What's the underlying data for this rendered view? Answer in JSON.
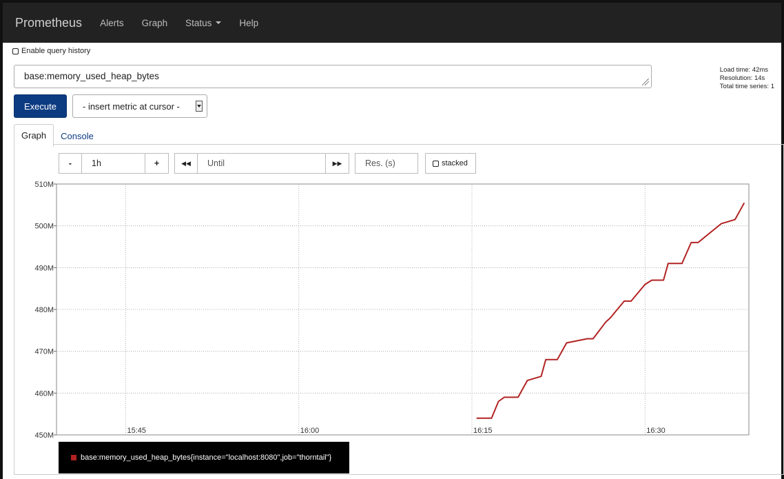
{
  "nav": {
    "brand": "Prometheus",
    "items": [
      "Alerts",
      "Graph",
      "Status",
      "Help"
    ]
  },
  "query_history_label": "Enable query history",
  "query": {
    "value": "base:memory_used_heap_bytes"
  },
  "stats": {
    "load_time": "Load time: 42ms",
    "resolution": "Resolution: 14s",
    "total_series": "Total time series: 1"
  },
  "execute_label": "Execute",
  "metric_select_label": "- insert metric at cursor -",
  "tabs": {
    "graph": "Graph",
    "console": "Console"
  },
  "controls": {
    "minus": "-",
    "range": "1h",
    "plus": "+",
    "back": "◀◀",
    "until_placeholder": "Until",
    "forward": "▶▶",
    "res_placeholder": "Res. (s)",
    "stacked_label": "stacked"
  },
  "colors": {
    "series": "#b22222",
    "execute": "#0c3b82",
    "nav_bg": "#222222"
  },
  "chart_data": {
    "type": "line",
    "ylim": [
      450,
      510
    ],
    "yticks": [
      450,
      460,
      470,
      480,
      490,
      500,
      510
    ],
    "ytick_labels": [
      "450M",
      "460M",
      "470M",
      "480M",
      "490M",
      "500M",
      "510M"
    ],
    "xlim": [
      0,
      60
    ],
    "xticks": [
      6,
      21,
      36,
      51
    ],
    "xtick_labels": [
      "15:45",
      "16:00",
      "16:15",
      "16:30"
    ],
    "grid": true,
    "series": [
      {
        "name": "base:memory_used_heap_bytes{instance=\"localhost:8080\",job=\"thorntail\"}",
        "color": "#b22222",
        "x": [
          36.4,
          37.7,
          38.3,
          38.8,
          40.0,
          40.8,
          42.0,
          42.4,
          43.4,
          44.2,
          46.0,
          46.5,
          47.6,
          48.0,
          49.2,
          49.8,
          51.0,
          51.6,
          52.6,
          53.0,
          54.2,
          55.0,
          55.6,
          57.6,
          58.8,
          59.6
        ],
        "y": [
          454,
          454,
          458,
          459,
          459,
          463,
          464,
          468,
          468,
          472,
          473,
          473,
          477,
          478,
          482,
          482,
          486,
          487,
          487,
          491,
          491,
          496,
          496,
          500.5,
          501.5,
          505.5
        ]
      }
    ],
    "legend_position": "bottom-left"
  }
}
